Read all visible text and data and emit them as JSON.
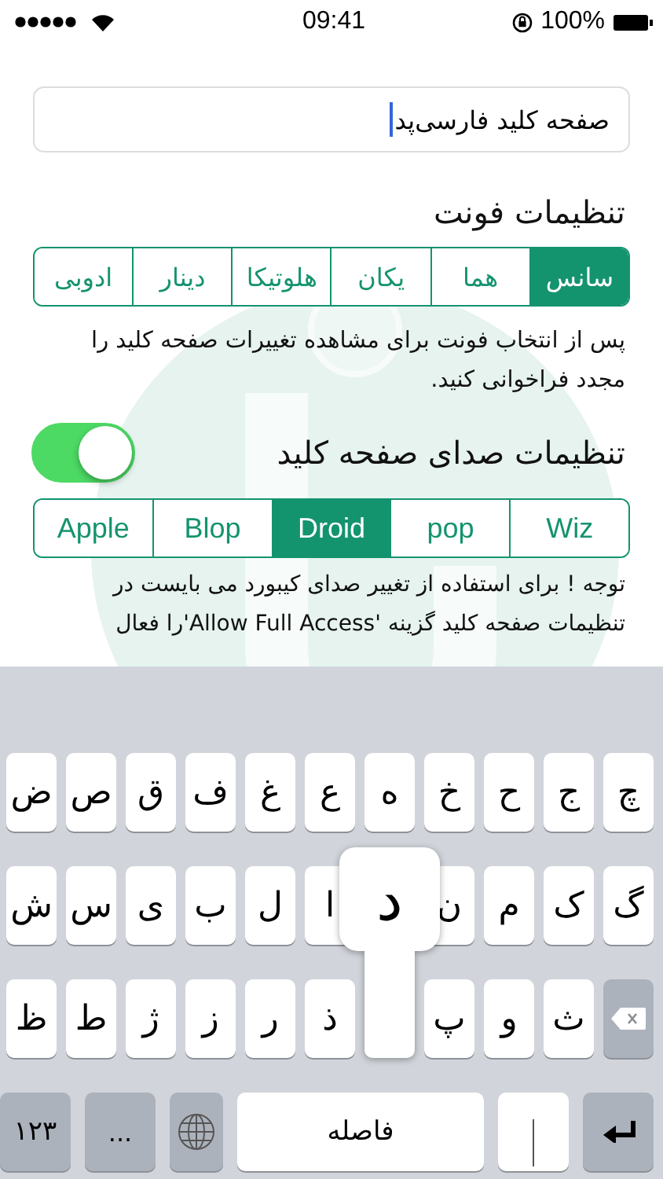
{
  "status_bar": {
    "time": "09:41",
    "battery": "100%"
  },
  "name_field": {
    "value": "صفحه کلید فارسی‌پد"
  },
  "font_settings": {
    "title": "تنظیمات فونت",
    "options": [
      {
        "label": "سانس",
        "selected": true
      },
      {
        "label": "هما",
        "selected": false
      },
      {
        "label": "یکان",
        "selected": false
      },
      {
        "label": "هلوتیکا",
        "selected": false
      },
      {
        "label": "دینار",
        "selected": false
      },
      {
        "label": "ادوبی",
        "selected": false
      }
    ],
    "hint": "پس از انتخاب فونت برای مشاهده تغییرات صفحه کلید را مجدد فراخوانی کنید."
  },
  "sound_settings": {
    "title": "تنظیمات صدای صفحه کلید",
    "enabled": true,
    "options": [
      {
        "label": "Wiz",
        "selected": false
      },
      {
        "label": "pop",
        "selected": false
      },
      {
        "label": "Droid",
        "selected": true
      },
      {
        "label": "Blop",
        "selected": false
      },
      {
        "label": "Apple",
        "selected": false
      }
    ],
    "note": "توجه ! برای استفاده از تغییر صدای کیبورد می بایست در تنظیمات صفحه کلید گزینه 'Allow Full Access'را فعال"
  },
  "keyboard": {
    "preview": {
      "label": "د"
    },
    "rows": [
      [
        {
          "label": "چ"
        },
        {
          "label": "ج"
        },
        {
          "label": "ح"
        },
        {
          "label": "خ"
        },
        {
          "label": "ه"
        },
        {
          "label": "ع"
        },
        {
          "label": "غ"
        },
        {
          "label": "ف"
        },
        {
          "label": "ق"
        },
        {
          "label": "ص"
        },
        {
          "label": "ض"
        }
      ],
      [
        {
          "label": "گ"
        },
        {
          "label": "ک"
        },
        {
          "label": "م"
        },
        {
          "label": "ن"
        },
        {
          "kind": "hidden"
        },
        {
          "label": "ا"
        },
        {
          "label": "ل"
        },
        {
          "label": "ب"
        },
        {
          "label": "ی"
        },
        {
          "label": "س"
        },
        {
          "label": "ش"
        }
      ],
      [
        {
          "kind": "backspace"
        },
        {
          "label": "ث"
        },
        {
          "label": "و"
        },
        {
          "label": "پ"
        },
        {
          "pressed": true
        },
        {
          "label": "ذ"
        },
        {
          "label": "ر"
        },
        {
          "label": "ز"
        },
        {
          "label": "ژ"
        },
        {
          "label": "ط"
        },
        {
          "label": "ظ"
        }
      ]
    ],
    "bottom_row": [
      {
        "kind": "return"
      },
      {
        "kind": "cursor"
      },
      {
        "kind": "space",
        "label": "فاصله"
      },
      {
        "kind": "globe"
      },
      {
        "kind": "more",
        "label": "..."
      },
      {
        "kind": "numbers",
        "label": "۱۲۳"
      }
    ]
  }
}
